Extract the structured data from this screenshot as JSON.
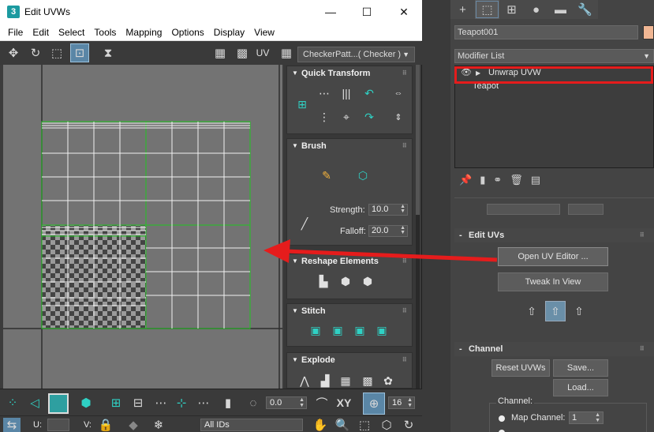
{
  "window": {
    "app_icon": "3",
    "title": "Edit UVWs",
    "minimize": "—",
    "maximize": "☐",
    "close": "✕"
  },
  "menu": [
    "File",
    "Edit",
    "Select",
    "Tools",
    "Mapping",
    "Options",
    "Display",
    "View"
  ],
  "toolbar": {
    "uv_label": "UV",
    "checker_dropdown": "CheckerPatt...( Checker )"
  },
  "tool_panel": {
    "quick_transform": {
      "title": "Quick Transform"
    },
    "brush": {
      "title": "Brush",
      "strength_label": "Strength:",
      "strength_value": "10.0",
      "falloff_label": "Falloff:",
      "falloff_value": "20.0"
    },
    "reshape": {
      "title": "Reshape Elements"
    },
    "stitch": {
      "title": "Stitch"
    },
    "explode": {
      "title": "Explode"
    }
  },
  "bottom_bar": {
    "angle_value": "0.0",
    "xy_label": "XY",
    "grid_value": "16",
    "u_label": "U:",
    "v_label": "V:",
    "ids_dropdown": "All IDs"
  },
  "command_panel": {
    "object_name": "Teapot001",
    "object_color": "#f0b693",
    "modifier_list": "Modifier List",
    "stack": [
      {
        "label": "Unwrap UVW",
        "highlighted": true
      },
      {
        "label": "Teapot",
        "highlighted": false
      }
    ],
    "edit_uvs": {
      "title": "Edit UVs",
      "open_editor": "Open UV Editor ...",
      "tweak_in_view": "Tweak In View"
    },
    "channel": {
      "title": "Channel",
      "reset_uvws": "Reset UVWs",
      "save": "Save...",
      "load": "Load...",
      "group_label": "Channel:",
      "map_channel_label": "Map Channel:",
      "map_channel_value": "1"
    }
  },
  "annotation": {
    "arrow_color": "#e51c1c",
    "highlight_color": "#e51c1c"
  }
}
